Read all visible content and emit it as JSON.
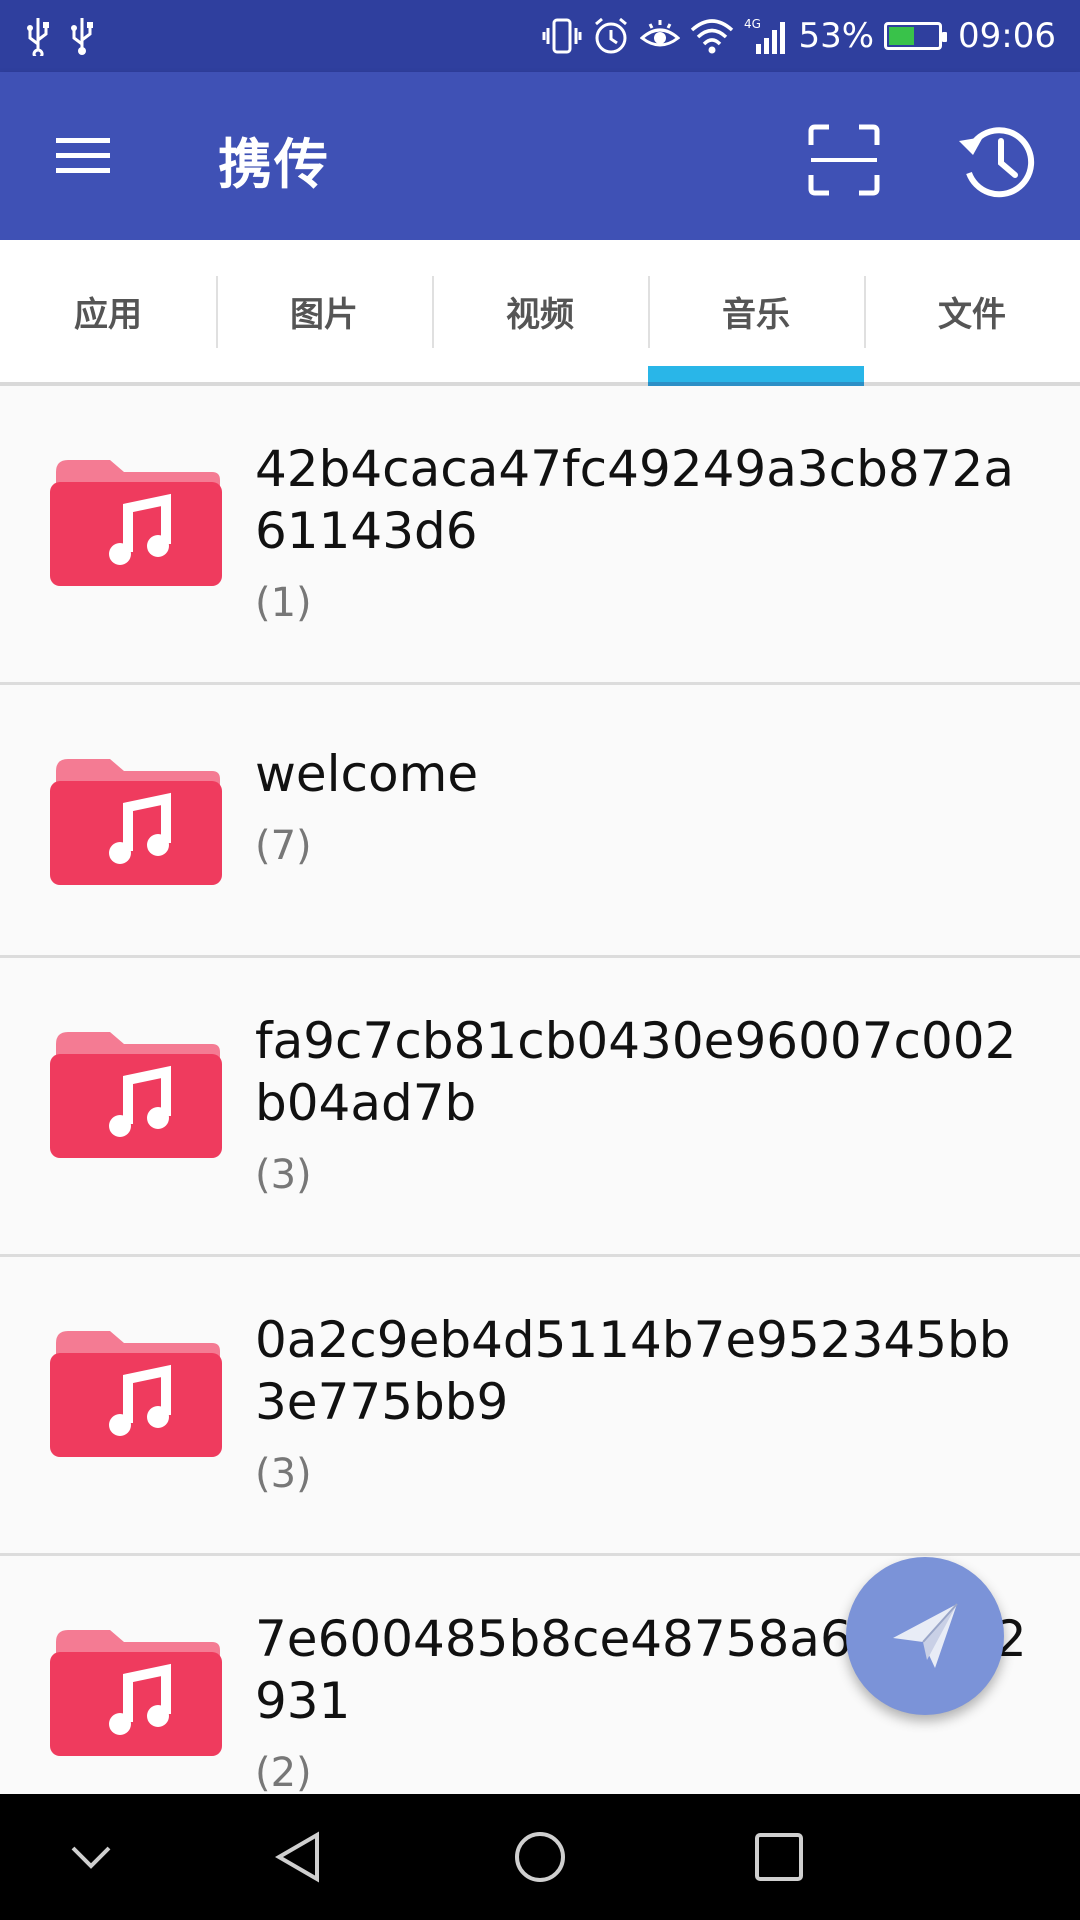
{
  "status_bar": {
    "left_icons": [
      "usb-icon",
      "usb-icon"
    ],
    "right_icons": [
      "vibrate-icon",
      "alarm-icon",
      "eye-comfort-icon",
      "wifi-icon",
      "signal-4g-icon"
    ],
    "network_label": "4G",
    "battery_percent": "53%",
    "battery_level": 0.53,
    "time": "09:06"
  },
  "app_bar": {
    "title": "携传",
    "menu_icon": "hamburger-menu-icon",
    "scan_icon": "scan-icon",
    "history_icon": "history-icon",
    "color": "#3f51b5"
  },
  "tabs": [
    {
      "label": "应用",
      "active": false
    },
    {
      "label": "图片",
      "active": false
    },
    {
      "label": "视频",
      "active": false
    },
    {
      "label": "音乐",
      "active": true
    },
    {
      "label": "文件",
      "active": false
    }
  ],
  "folders": [
    {
      "name": "42b4caca47fc49249a3cb872a61143d6",
      "count": "(1)"
    },
    {
      "name": "welcome",
      "count": "(7)"
    },
    {
      "name": "fa9c7cb81cb0430e96007c002b04ad7b",
      "count": "(3)"
    },
    {
      "name": "0a2c9eb4d5114b7e952345bb3e775bb9",
      "count": "(3)"
    },
    {
      "name": "7e600485b8ce48758a63        27b2931",
      "count": "(2)"
    }
  ],
  "folder_icon": "music-folder-icon",
  "folder_color": "#ef3b5e",
  "fab_icon": "send-paper-plane-icon",
  "nav_bar": {
    "icons": [
      "hide-nav-icon",
      "back-icon",
      "home-icon",
      "recents-icon"
    ]
  }
}
